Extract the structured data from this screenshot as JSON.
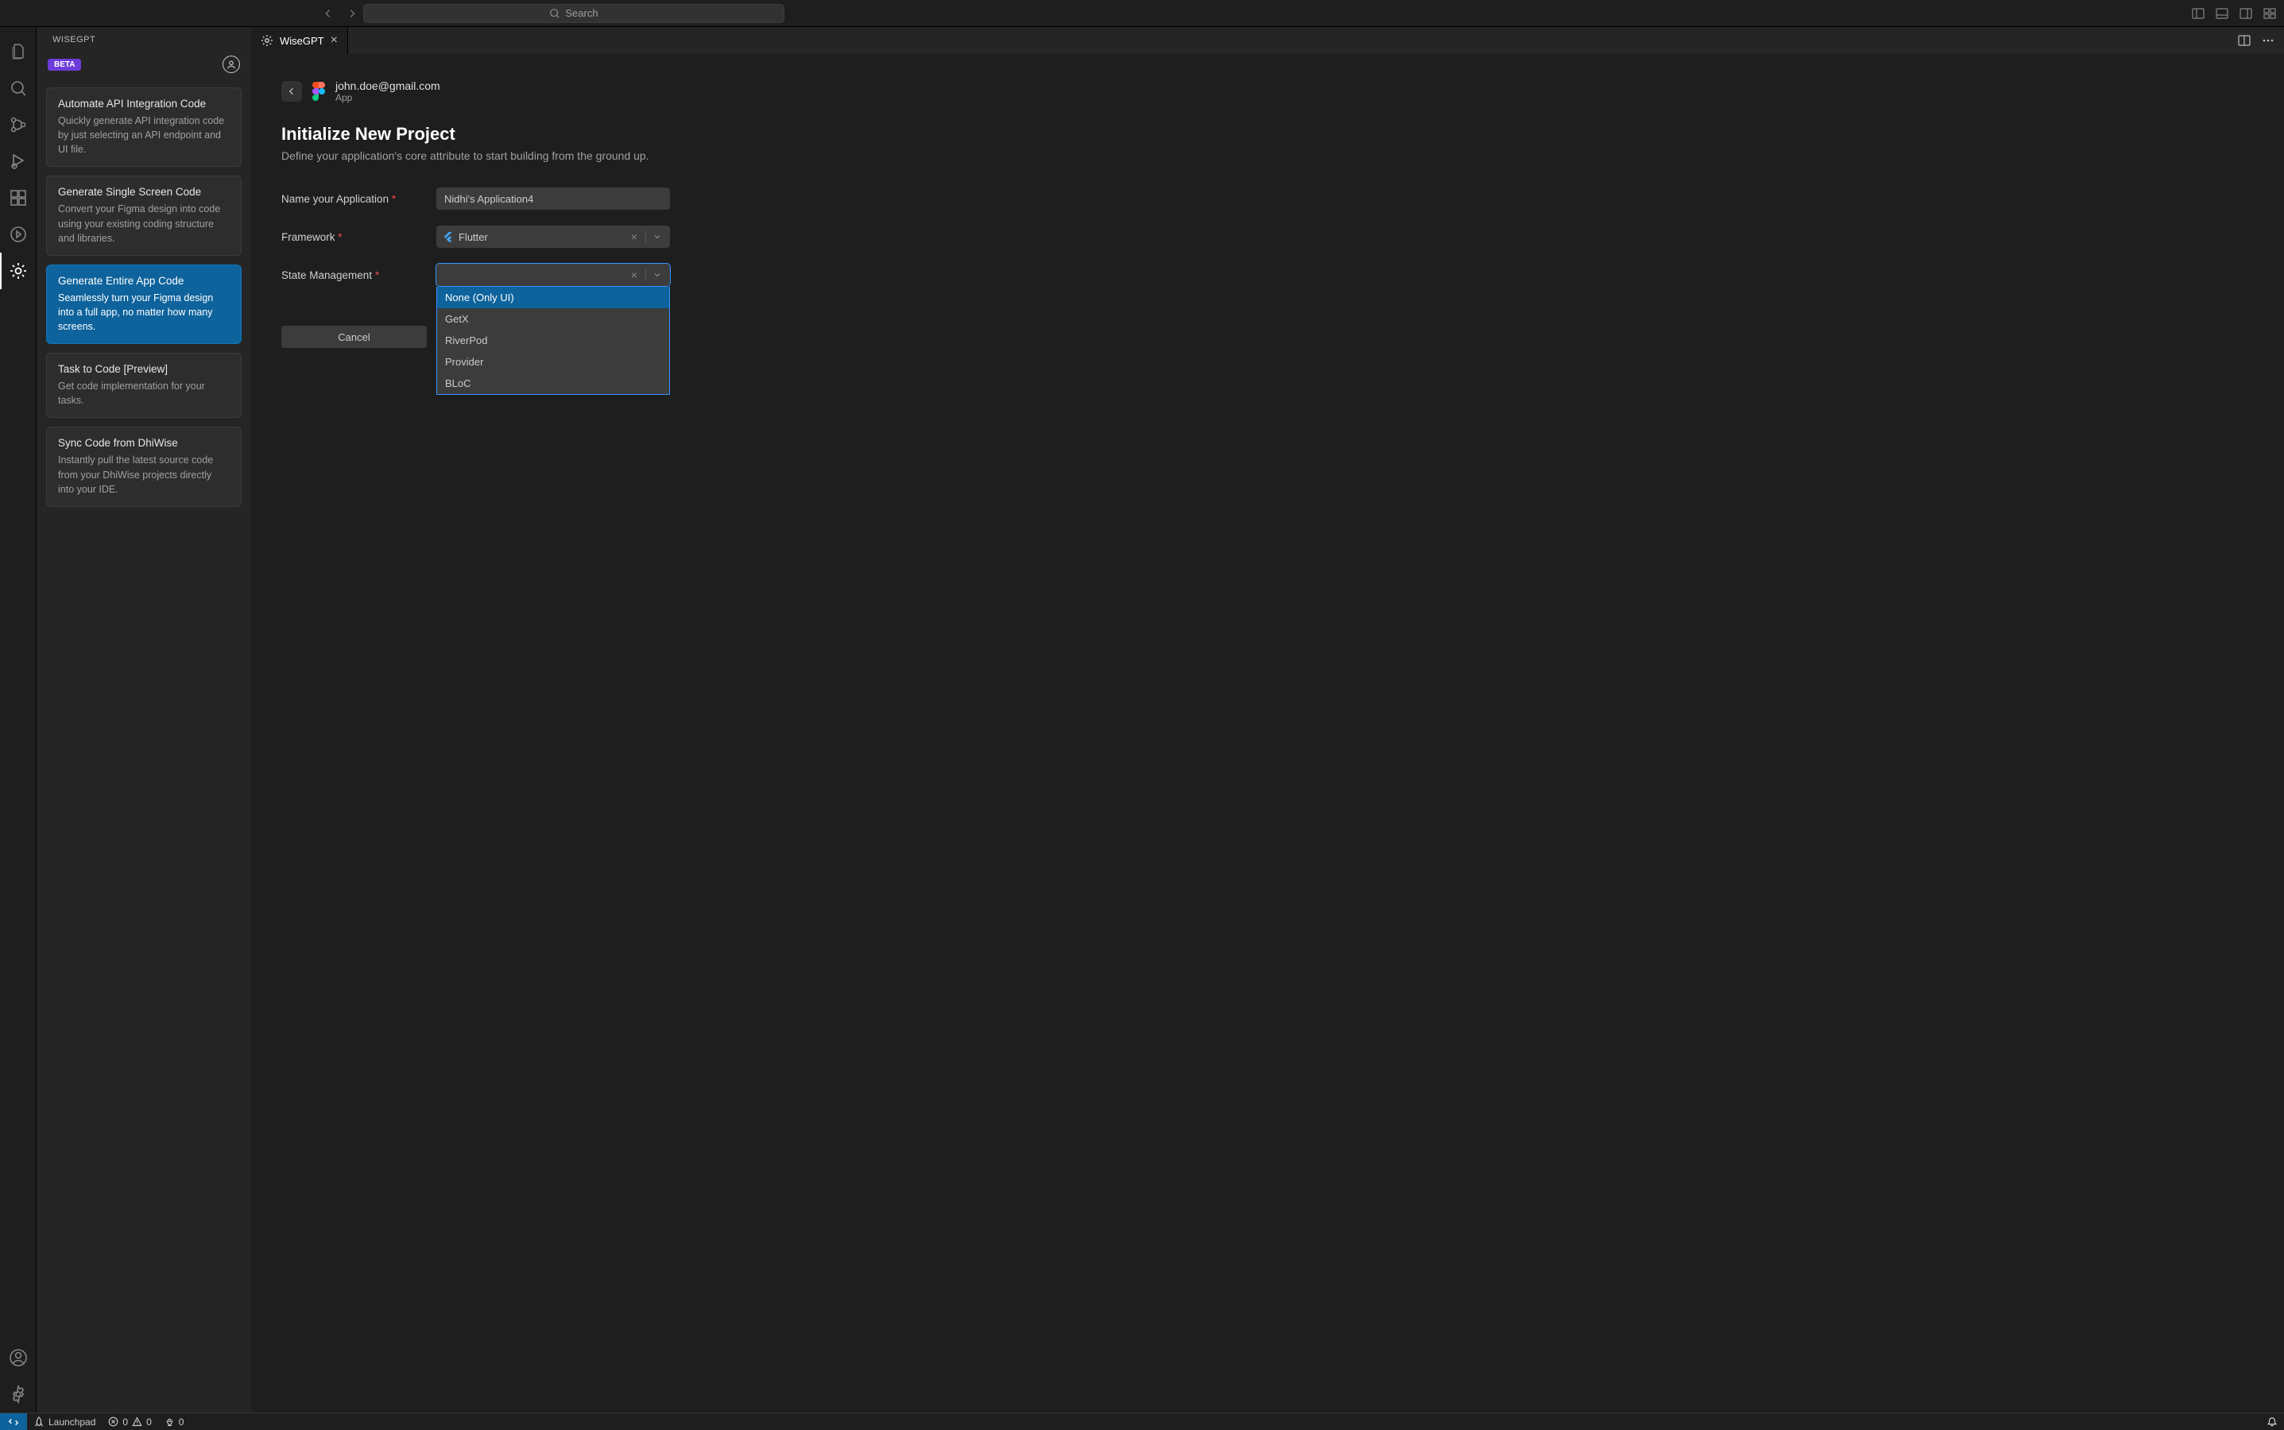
{
  "titlebar": {
    "search_placeholder": "Search"
  },
  "sidebar": {
    "title": "WISEGPT",
    "beta_label": "BETA",
    "cards": [
      {
        "title": "Automate API Integration Code",
        "desc": "Quickly generate API integration code by just selecting an API endpoint and UI file."
      },
      {
        "title": "Generate Single Screen Code",
        "desc": "Convert your Figma design into code using your existing coding structure and libraries."
      },
      {
        "title": "Generate Entire App Code",
        "desc": "Seamlessly turn your Figma design into a full app, no matter how many screens."
      },
      {
        "title": "Task to Code [Preview]",
        "desc": "Get code implementation for your tasks."
      },
      {
        "title": "Sync Code from DhiWise",
        "desc": "Instantly pull the latest source code from your DhiWise projects directly into your IDE."
      }
    ]
  },
  "tab": {
    "label": "WiseGPT"
  },
  "breadcrumb": {
    "email": "john.doe@gmail.com",
    "sub": "App"
  },
  "page": {
    "title": "Initialize New Project",
    "subtitle": "Define your application's core attribute to start building from the ground up."
  },
  "form": {
    "name_label": "Name your Application",
    "name_value": "Nidhi's Application4",
    "framework_label": "Framework",
    "framework_value": "Flutter",
    "state_label": "State Management",
    "state_options": [
      "None (Only UI)",
      "GetX",
      "RiverPod",
      "Provider",
      "BLoC"
    ]
  },
  "buttons": {
    "cancel": "Cancel"
  },
  "statusbar": {
    "launchpad": "Launchpad",
    "errors": "0",
    "warnings": "0",
    "ports": "0"
  }
}
